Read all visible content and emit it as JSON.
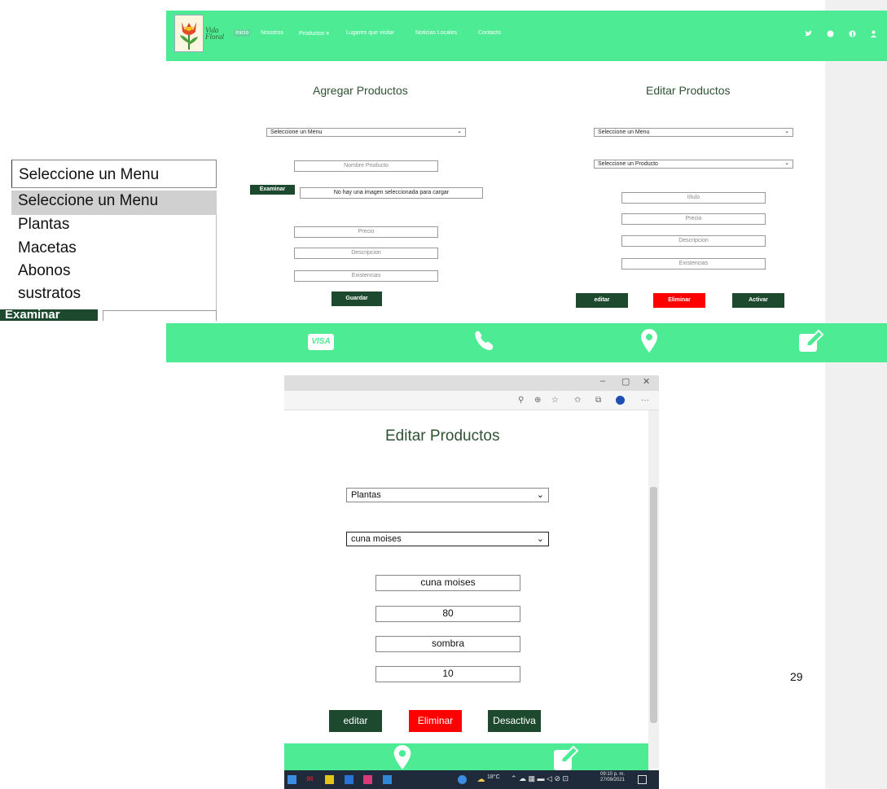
{
  "page": {
    "number": "29"
  },
  "top": {
    "logo_text": "Vida Floral",
    "nav": [
      "Inicio",
      "Nosotros",
      "Productos",
      "Lugares que visitar",
      "Noticias Locales",
      "Contacto"
    ],
    "nav_caret": "▾",
    "agregar": {
      "title": "Agregar Productos",
      "menu_select": "Seleccione un Menu",
      "nombre_placeholder": "Nombre Producto",
      "examinar_label": "Examinar",
      "file_status": "No hay una imagen seleccionada para cargar",
      "precio_placeholder": "Precio",
      "descripcion_placeholder": "Descripcion",
      "existencias_placeholder": "Existencias",
      "guardar_label": "Guardar"
    },
    "editar": {
      "title": "Editar Productos",
      "menu_select": "Seleccione un Menu",
      "product_select": "Seleccione un Producto",
      "titulo_placeholder": "título",
      "precio_placeholder": "Precio",
      "descripcion_placeholder": "Descripcion",
      "existencias_placeholder": "Existencias",
      "editar_label": "editar",
      "eliminar_label": "Eliminar",
      "activar_label": "Activar"
    },
    "footer_visa": "VISA"
  },
  "dropdown": {
    "value": "Seleccione un Menu",
    "options": [
      "Seleccione un Menu",
      "Plantas",
      "Macetas",
      "Abonos",
      "sustratos"
    ],
    "cut_button": "Examinar"
  },
  "bottom": {
    "title": "Editar Productos",
    "menu_value": "Plantas",
    "product_value": "cuna moises",
    "titulo_value": "cuna moises",
    "precio_value": "80",
    "descripcion_value": "sombra",
    "existencias_value": "10",
    "editar_label": "editar",
    "eliminar_label": "Eliminar",
    "desactivar_label": "Desactiva",
    "taskbar": {
      "weather": "18°C",
      "time": "09:10 p. m.",
      "date": "27/09/2021"
    }
  },
  "colors": {
    "accent": "#4deb94",
    "dark_button": "#1d4a2e",
    "danger": "#ff0000",
    "heading": "#2f5233"
  },
  "icons": [
    "twitter-icon",
    "instagram-icon",
    "facebook-icon",
    "user-icon",
    "visa-icon",
    "phone-icon",
    "location-icon",
    "edit-icon"
  ]
}
